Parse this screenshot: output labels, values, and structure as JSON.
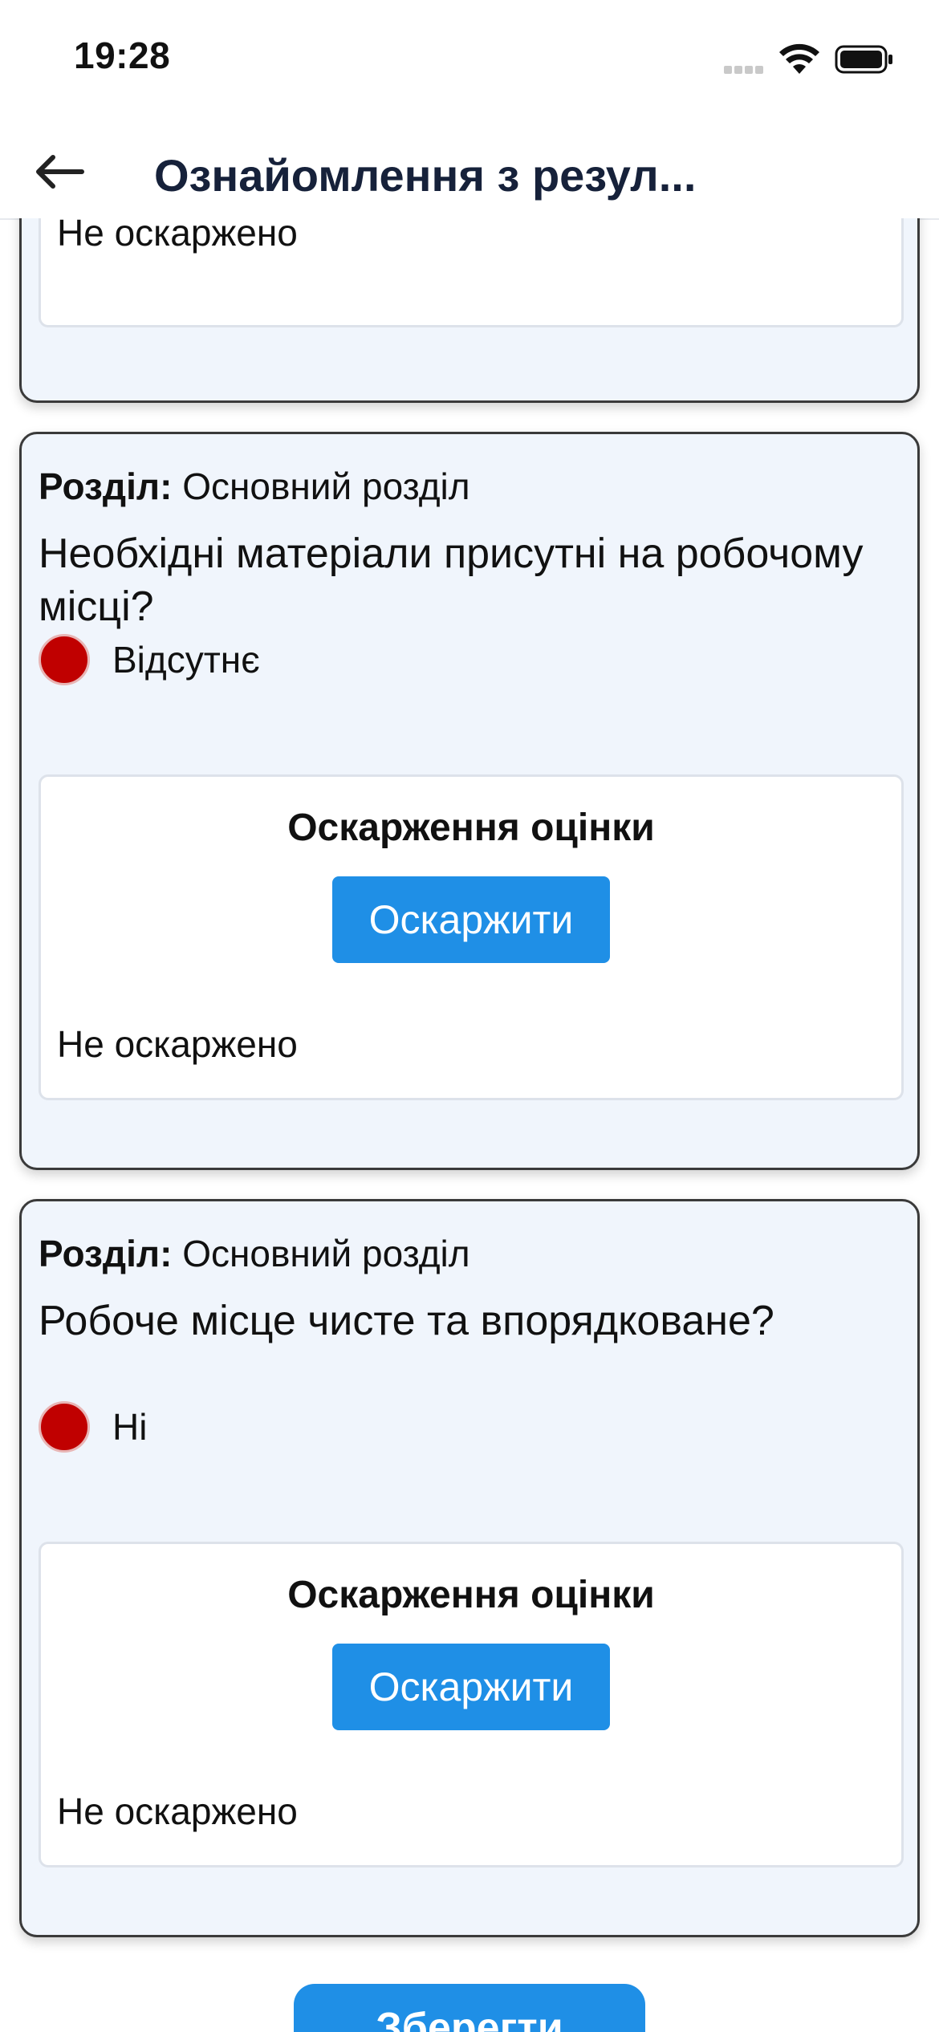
{
  "status_bar": {
    "time": "19:28"
  },
  "header": {
    "title": "Ознайомлення з резул..."
  },
  "top_card": {
    "appeal_status": "Не оскаржено"
  },
  "cards": [
    {
      "section_label": "Розділ:",
      "section_name": "Основний розділ",
      "question": "Необхідні матеріали присутні на робочому місці?",
      "answer": "Відсутнє",
      "answer_color": "#c00000",
      "appeal_title": "Оскарження оцінки",
      "appeal_button": "Оскаржити",
      "appeal_status": "Не оскаржено"
    },
    {
      "section_label": "Розділ:",
      "section_name": "Основний розділ",
      "question": "Робоче місце чисте та впорядковане?",
      "answer": "Ні",
      "answer_color": "#c00000",
      "appeal_title": "Оскарження оцінки",
      "appeal_button": "Оскаржити",
      "appeal_status": "Не оскаржено"
    }
  ],
  "footer": {
    "save_button": "Зберегти"
  },
  "colors": {
    "accent": "#1f8fe6",
    "card_bg": "#f0f5fc",
    "negative": "#c00000"
  }
}
